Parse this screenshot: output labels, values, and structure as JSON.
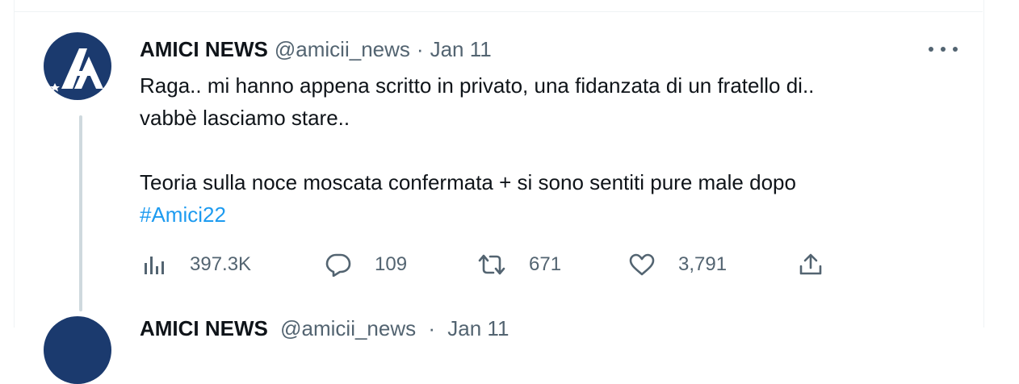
{
  "tweet": {
    "author_name": "AMICI NEWS",
    "handle": "@amicii_news",
    "separator": "·",
    "date": "Jan 11",
    "text_lines": [
      "Raga.. mi hanno appena scritto in privato, una fidanzata di un fratello di..",
      "vabbè lasciamo stare..",
      "Teoria sulla noce moscata confermata + si sono sentiti pure male dopo"
    ],
    "hashtag": "#Amici22",
    "views": "397.3K",
    "replies": "109",
    "retweets": "671",
    "likes": "3,791",
    "icons": [
      "more-icon",
      "views-icon",
      "reply-icon",
      "retweet-icon",
      "like-icon",
      "share-icon"
    ]
  },
  "next_tweet": {
    "author_name": "AMICI NEWS",
    "handle": "@amicii_news",
    "separator": "·",
    "date": "Jan 11"
  },
  "colors": {
    "text": "#0f1419",
    "secondary": "#536471",
    "link": "#1d9bf0",
    "avatar_bg": "#1b3a6e",
    "thread_line": "#cfd9de"
  }
}
